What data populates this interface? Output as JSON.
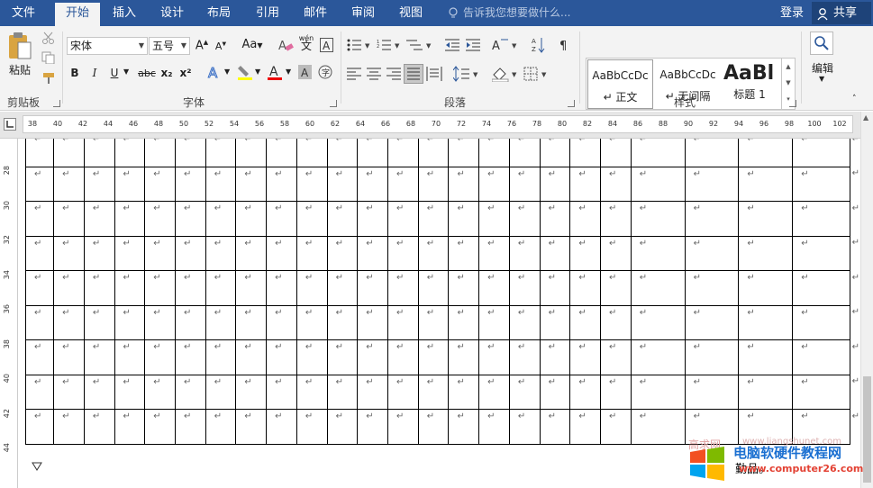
{
  "tabs": [
    "文件",
    "开始",
    "插入",
    "设计",
    "布局",
    "引用",
    "邮件",
    "审阅",
    "视图"
  ],
  "active_tab": "开始",
  "tell_me": "告诉我您想要做什么...",
  "login": "登录",
  "share": "共享",
  "clipboard": {
    "paste": "粘贴",
    "label": "剪贴板"
  },
  "font": {
    "name": "宋体",
    "size": "五号",
    "label": "字体",
    "aa_upper": "A",
    "aa_case": "Aa",
    "wen": "wén",
    "bold": "B",
    "italic": "I",
    "underline": "U",
    "strike": "abc",
    "sub": "x₂",
    "sup": "x²"
  },
  "paragraph": {
    "label": "段落"
  },
  "styles": {
    "label": "样式",
    "items": [
      {
        "preview": "AaBbCcDc",
        "name": "↵ 正文"
      },
      {
        "preview": "AaBbCcDc",
        "name": "↵ 无间隔"
      },
      {
        "preview": "AaBl",
        "name": "标题 1"
      }
    ]
  },
  "editing": {
    "label": "编辑"
  },
  "hruler_ticks": [
    "38",
    "40",
    "42",
    "44",
    "46",
    "48",
    "50",
    "52",
    "54",
    "56",
    "58",
    "60",
    "62",
    "64",
    "66",
    "68",
    "70",
    "72",
    "74",
    "76",
    "78",
    "80",
    "82",
    "84",
    "86",
    "88",
    "90",
    "92",
    "94",
    "96",
    "98",
    "100",
    "102"
  ],
  "vruler_ticks": [
    "28",
    "30",
    "32",
    "34",
    "36",
    "38",
    "40",
    "42",
    "44"
  ],
  "table": {
    "rows": 9,
    "cols": 24,
    "cell_mark": "↵"
  },
  "footer_text": "勤品。",
  "watermark": {
    "site": "电脑软硬件教程网",
    "url": "www.computer26.com",
    "faint": "高求网",
    "faint_url": "www.liangshunet.com"
  }
}
